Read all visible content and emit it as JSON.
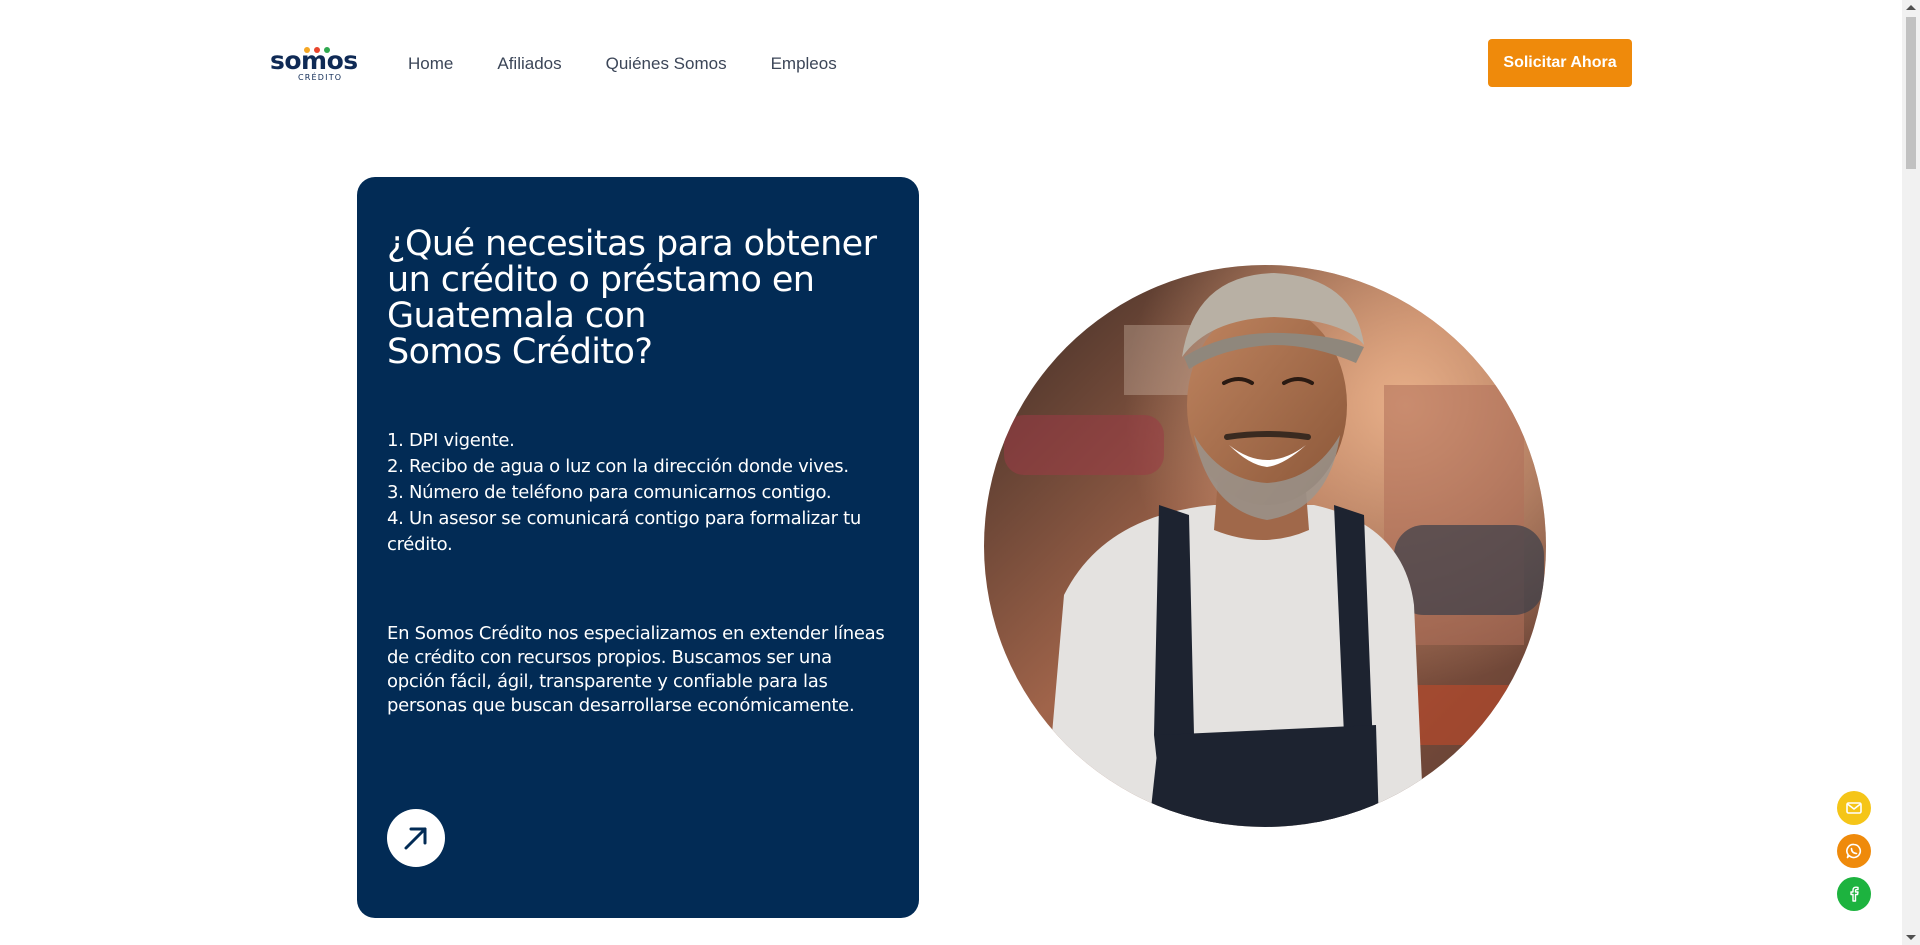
{
  "brand": {
    "name": "somos",
    "subtitle": "CRÉDITO",
    "dot_colors": [
      "#f5a623",
      "#e8452c",
      "#2fa84f"
    ],
    "primary_color": "#022b55",
    "accent_color": "#ef8a0b"
  },
  "nav": {
    "items": [
      {
        "label": "Home"
      },
      {
        "label": "Afiliados"
      },
      {
        "label": "Quiénes Somos"
      },
      {
        "label": "Empleos"
      }
    ],
    "cta_label": "Solicitar Ahora"
  },
  "card": {
    "title_lines": [
      "¿Qué necesitas para obtener",
      "un crédito o préstamo en",
      "Guatemala con",
      "Somos Crédito?"
    ],
    "requirements": [
      "1. DPI vigente.",
      "2. Recibo de agua o luz con la dirección donde vives.",
      "3. Número de teléfono para comunicarnos contigo.",
      "4. Un asesor se comunicará contigo para formalizar tu crédito."
    ],
    "description": "En Somos Crédito nos especializamos en extender líneas de crédito con recursos propios. Buscamos ser una opción fácil, ágil, transparente y confiable para las personas que buscan desarrollarse económicamente.",
    "arrow_icon": "arrow-up-right-icon"
  },
  "floating_buttons": [
    {
      "icon": "mail-icon",
      "color": "#f5c518"
    },
    {
      "icon": "whatsapp-icon",
      "color": "#ef8a0b"
    },
    {
      "icon": "facebook-icon",
      "color": "#1db33f"
    }
  ]
}
